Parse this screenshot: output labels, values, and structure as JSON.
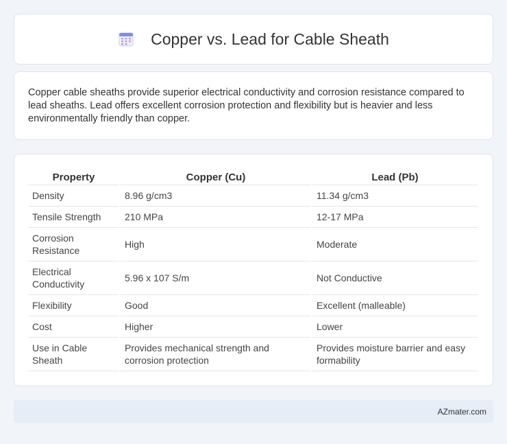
{
  "header": {
    "title": "Copper vs. Lead for Cable Sheath",
    "icon": "calendar-icon"
  },
  "intro": {
    "text": "Copper cable sheaths provide superior electrical conductivity and corrosion resistance compared to lead sheaths. Lead offers excellent corrosion protection and flexibility but is heavier and less environmentally friendly than copper."
  },
  "table": {
    "headers": [
      "Property",
      "Copper (Cu)",
      "Lead (Pb)"
    ],
    "rows": [
      [
        "Density",
        "8.96 g/cm3",
        "11.34 g/cm3"
      ],
      [
        "Tensile Strength",
        "210 MPa",
        "12-17 MPa"
      ],
      [
        "Corrosion Resistance",
        "High",
        "Moderate"
      ],
      [
        "Electrical Conductivity",
        "5.96 x 107 S/m",
        "Not Conductive"
      ],
      [
        "Flexibility",
        "Good",
        "Excellent (malleable)"
      ],
      [
        "Cost",
        "Higher",
        "Lower"
      ],
      [
        "Use in Cable Sheath",
        "Provides mechanical strength and corrosion protection",
        "Provides moisture barrier and easy formability"
      ]
    ]
  },
  "footer": {
    "brand": "AZmater.com"
  }
}
